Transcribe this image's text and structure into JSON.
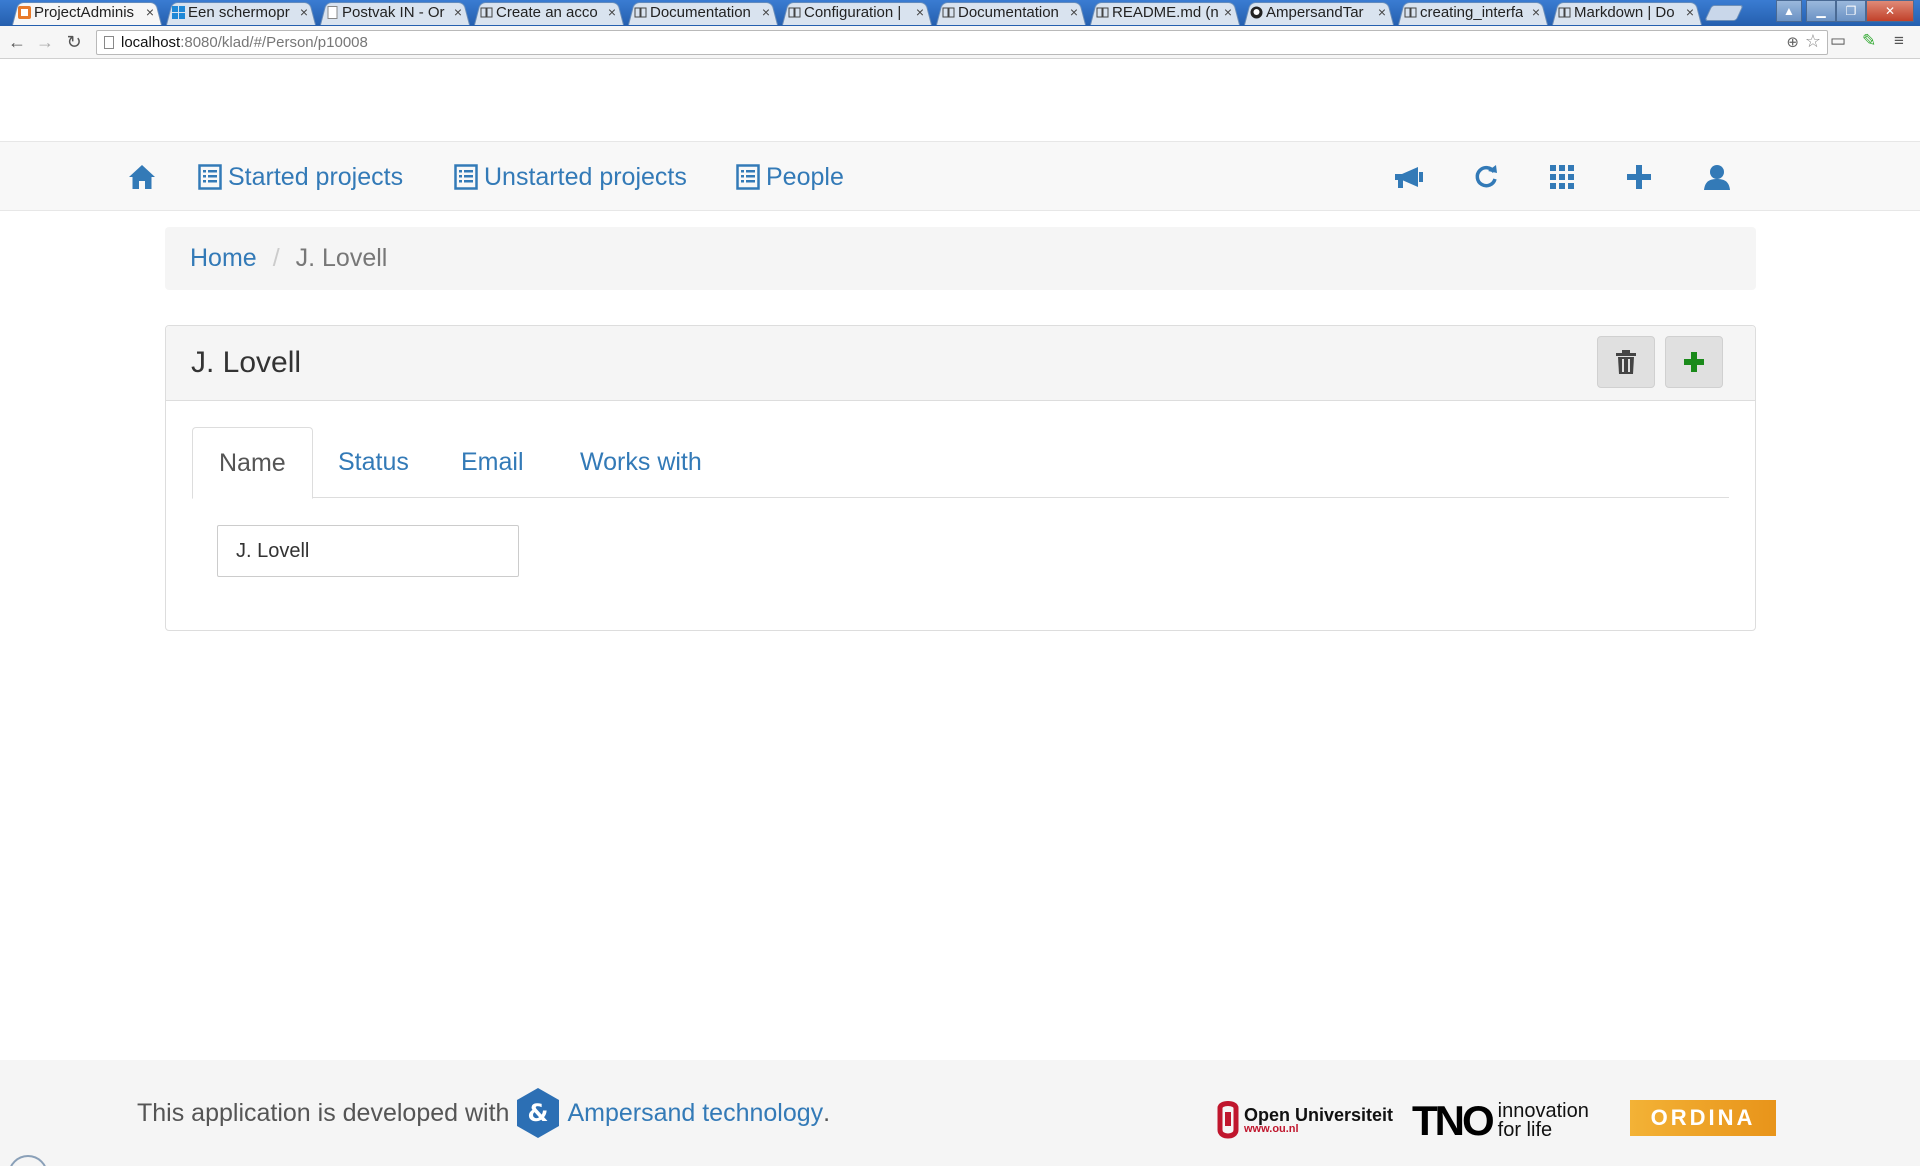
{
  "browser": {
    "tabs": [
      {
        "label": "ProjectAdminis",
        "active": true,
        "icon": "ampersand-favicon"
      },
      {
        "label": "Een schermopr",
        "icon": "windows-favicon"
      },
      {
        "label": "Postvak IN - Or",
        "icon": "page-favicon"
      },
      {
        "label": "Create an acco",
        "icon": "book-favicon"
      },
      {
        "label": "Documentation",
        "icon": "book-favicon"
      },
      {
        "label": "Configuration |",
        "icon": "book-favicon"
      },
      {
        "label": "Documentation",
        "icon": "book-favicon"
      },
      {
        "label": "README.md (n",
        "icon": "book-favicon"
      },
      {
        "label": "AmpersandTar",
        "icon": "github-favicon"
      },
      {
        "label": "creating_interfa",
        "icon": "book-favicon"
      },
      {
        "label": "Markdown | Do",
        "icon": "book-favicon"
      }
    ],
    "tab_close": "×",
    "url_host": "localhost",
    "url_path": ":8080/klad/#/Person/p10008"
  },
  "navbar": {
    "items": [
      {
        "label": "Started projects"
      },
      {
        "label": "Unstarted projects"
      },
      {
        "label": "People"
      }
    ],
    "right_icons": [
      "megaphone-icon",
      "refresh-icon",
      "grid-icon",
      "plus-icon",
      "user-icon"
    ]
  },
  "breadcrumb": {
    "home": "Home",
    "separator": "/",
    "current": "J. Lovell"
  },
  "panel": {
    "title": "J. Lovell",
    "tabs": [
      {
        "label": "Name",
        "active": true
      },
      {
        "label": "Status"
      },
      {
        "label": "Email"
      },
      {
        "label": "Works with"
      }
    ],
    "name_value": "J. Lovell"
  },
  "footer": {
    "text": "This application is developed with",
    "link": "Ampersand technology",
    "period": ".",
    "logos": {
      "ou_name": "Open Universiteit",
      "ou_url": "www.ou.nl",
      "tno_mark": "TNO",
      "tno_slogan_1": "innovation",
      "tno_slogan_2": "for life",
      "ordina": "ORDINA"
    }
  },
  "colors": {
    "link": "#337ab7",
    "plus_green": "#1a8a1a",
    "navbar_bg": "#f8f8f8"
  }
}
